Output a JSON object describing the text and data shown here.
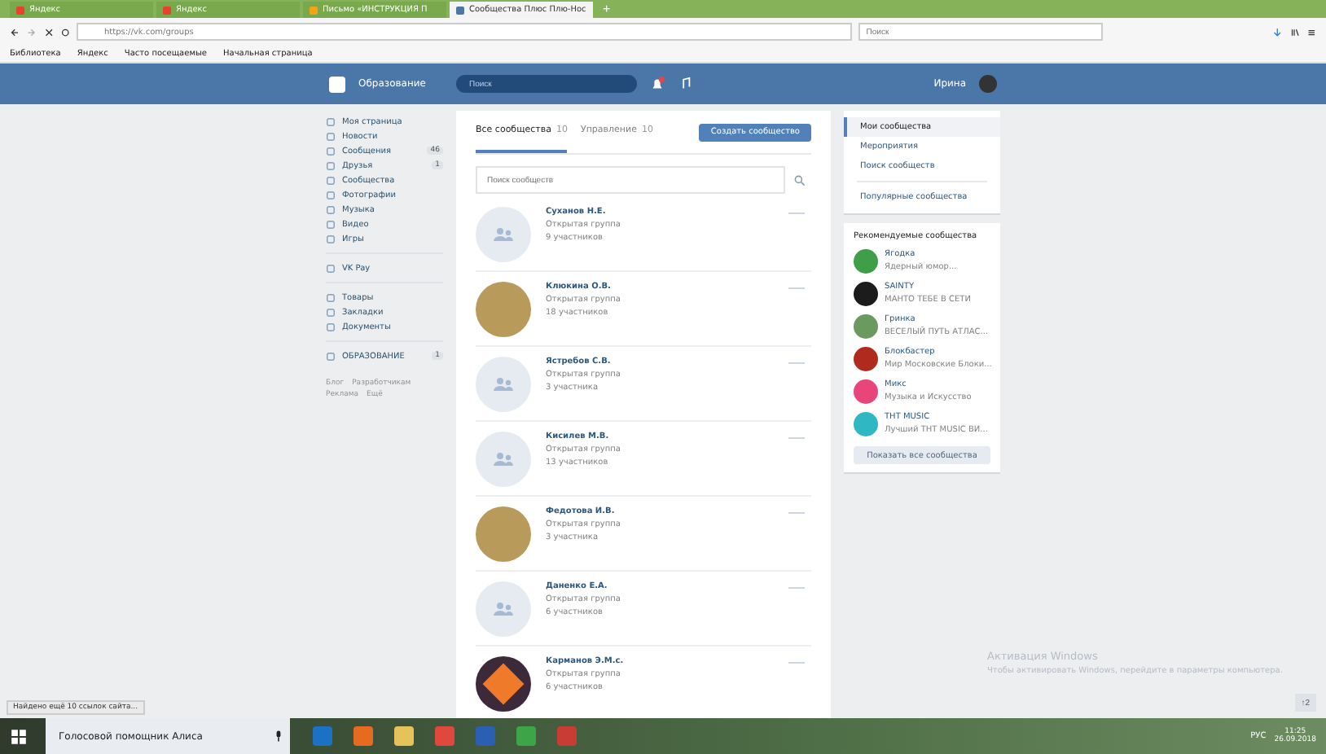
{
  "browser": {
    "tabs": [
      {
        "title": "Яндекс",
        "selected": false,
        "color": "#e8412c"
      },
      {
        "title": "Яндекс",
        "selected": false,
        "color": "#e8412c"
      },
      {
        "title": "Письмо «ИНСТРУКЦИЯ П",
        "selected": false,
        "color": "#f2a416"
      },
      {
        "title": "Сообщества Плюс Плю-Нос",
        "selected": true,
        "color": "#4a76a8"
      }
    ],
    "new_tab": "+",
    "address": "https://vk.com/groups",
    "search_placeholder": "Поиск",
    "bookmarks": [
      "Библиотека",
      "Яндекс",
      "Часто посещаемые",
      "Начальная страница"
    ]
  },
  "vk_header": {
    "logo": "Образование",
    "search_placeholder": "Поиск",
    "user": "Ирина"
  },
  "left_menu": {
    "items": [
      {
        "label": "Моя страница"
      },
      {
        "label": "Новости"
      },
      {
        "label": "Сообщения",
        "badge": "46"
      },
      {
        "label": "Друзья",
        "badge": "1"
      },
      {
        "label": "Сообщества"
      },
      {
        "label": "Фотографии"
      },
      {
        "label": "Музыка"
      },
      {
        "label": "Видео"
      },
      {
        "label": "Игры"
      },
      {
        "label": "VK Pay",
        "gap_before": true
      },
      {
        "label": "Товары",
        "gap_before": true
      },
      {
        "label": "Закладки"
      },
      {
        "label": "Документы"
      },
      {
        "label": "ОБРАЗОВАНИЕ",
        "badge": "1",
        "gap_before": true
      }
    ],
    "footer": [
      "Блог",
      "Разработчикам",
      "Реклама",
      "Ещё"
    ]
  },
  "groups": {
    "tabs": [
      {
        "label": "Все сообщества",
        "count": "10",
        "selected": true
      },
      {
        "label": "Управление",
        "count": "10",
        "selected": false
      }
    ],
    "create_button": "Создать сообщество",
    "search_placeholder": "Поиск сообществ",
    "rows": [
      {
        "name": "Суханов Н.Е.",
        "type": "Открытая группа",
        "members": "9 участников",
        "kind": "default"
      },
      {
        "name": "Клюкина О.В.",
        "type": "Открытая группа",
        "members": "18 участников",
        "kind": "photo"
      },
      {
        "name": "Ястребов С.В.",
        "type": "Открытая группа",
        "members": "3 участника",
        "kind": "default"
      },
      {
        "name": "Кисилев М.В.",
        "type": "Открытая группа",
        "members": "13 участников",
        "kind": "default"
      },
      {
        "name": "Федотова И.В.",
        "type": "Открытая группа",
        "members": "3 участника",
        "kind": "photo"
      },
      {
        "name": "Даненко Е.А.",
        "type": "Открытая группа",
        "members": "6 участников",
        "kind": "default"
      },
      {
        "name": "Карманов Э.М.с.",
        "type": "Открытая группа",
        "members": "6 участников",
        "kind": "logo"
      }
    ]
  },
  "right_menu": {
    "items": [
      {
        "label": "Мои сообщества",
        "selected": true
      },
      {
        "label": "Мероприятия",
        "selected": false
      },
      {
        "label": "Поиск сообществ",
        "selected": false
      },
      {
        "label": "Популярные сообщества",
        "selected": false
      }
    ]
  },
  "recommended": {
    "title": "Рекомендуемые сообщества",
    "items": [
      {
        "name": "Ягодка",
        "subtitle": "Ядерный юмор...",
        "color": "#3f9e48"
      },
      {
        "name": "SAINTY",
        "subtitle": "МАНТО ТЕБЕ В СЕТИ",
        "color": "#1c1c1c"
      },
      {
        "name": "Гринка",
        "subtitle": "ВЕСЕЛЫЙ ПУТЬ АТЛАС...",
        "color": "#6a9a5e"
      },
      {
        "name": "Блокбастер",
        "subtitle": "Мир Московские Блоки...",
        "color": "#b02a1e"
      },
      {
        "name": "Микс",
        "subtitle": "Музыка и Искусство",
        "color": "#e8467a"
      },
      {
        "name": "ТНТ MUSIC",
        "subtitle": "Лучший ТНТ MUSIC ВИ...",
        "color": "#2fb8c4"
      }
    ],
    "button": "Показать все сообщества"
  },
  "status_link": "Найдено ещё 10 ссылок сайта...",
  "activation": {
    "title": "Активация Windows",
    "text": "Чтобы активировать Windows, перейдите в параметры компьютера."
  },
  "scroll_up": "↑2",
  "taskbar": {
    "search": "Голосовой помощник Алиса",
    "language": "РУС",
    "time": "11:25",
    "date": "26.09.2018"
  }
}
